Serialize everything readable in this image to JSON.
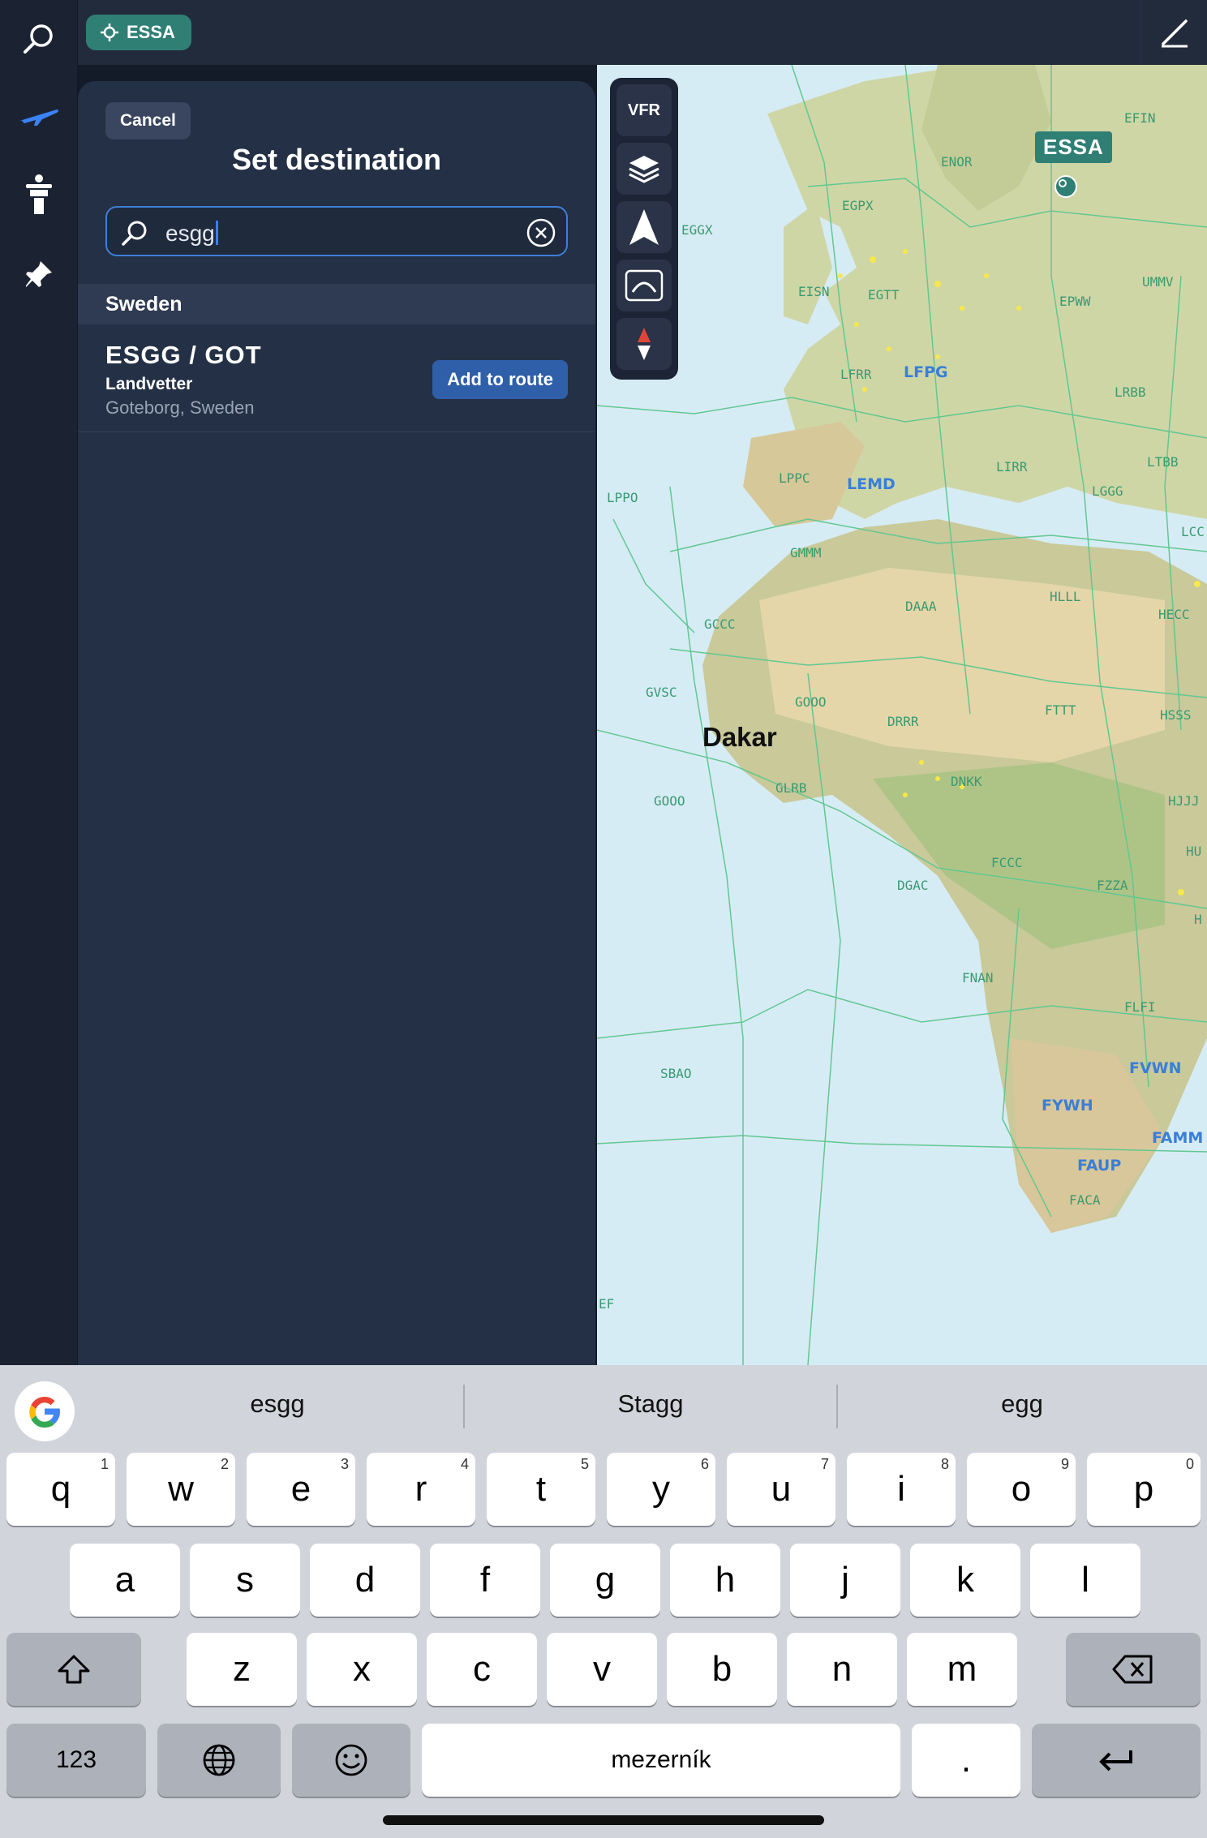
{
  "topbar": {
    "origin_chip": "ESSA"
  },
  "sheet": {
    "cancel_label": "Cancel",
    "title": "Set destination",
    "search_value": "esgg",
    "section": "Sweden",
    "result": {
      "code": "ESGG / GOT",
      "name": "Landvetter",
      "location": "Goteborg, Sweden",
      "action": "Add to route"
    }
  },
  "map": {
    "tools": [
      "VFR",
      "layers-icon",
      "navigation-arrow-icon",
      "route-icon",
      "compass-icon"
    ],
    "vfr_label": "VFR",
    "origin_tag": "ESSA",
    "city": "Dakar",
    "fir_labels": [
      "EFIN",
      "ENOR",
      "EGPX",
      "EGGX",
      "EISN",
      "EGTT",
      "UMMV",
      "EPWW",
      "LFRR",
      "LRBB",
      "LPPC",
      "LIRR",
      "LTBB",
      "LPPO",
      "LGGG",
      "LCC",
      "GMMM",
      "HLLL",
      "DAAA",
      "HECC",
      "GCCC",
      "GVSC",
      "GOOO",
      "FTTT",
      "HSSS",
      "DRRR",
      "DNKK",
      "GLRB",
      "GOOO",
      "HJJJ",
      "HU",
      "FCCC",
      "DGAC",
      "FZZA",
      "H",
      "FNAN",
      "FLFI",
      "SBAO",
      "FACA",
      "EF"
    ],
    "airports": [
      "LFPG",
      "LEMD",
      "FVWN",
      "FYWH",
      "FAMM",
      "FAUP"
    ],
    "colors": {
      "sea": "#d6ecf5",
      "land": "#c9d4a3",
      "fir_line": "#63c790",
      "airport": "#3a7ed8",
      "accent": "#2f7f74"
    }
  },
  "keyboard": {
    "suggestions": [
      "esgg",
      "Stagg",
      "egg"
    ],
    "row1": [
      [
        "q",
        "1"
      ],
      [
        "w",
        "2"
      ],
      [
        "e",
        "3"
      ],
      [
        "r",
        "4"
      ],
      [
        "t",
        "5"
      ],
      [
        "y",
        "6"
      ],
      [
        "u",
        "7"
      ],
      [
        "i",
        "8"
      ],
      [
        "o",
        "9"
      ],
      [
        "p",
        "0"
      ]
    ],
    "row2": [
      "a",
      "s",
      "d",
      "f",
      "g",
      "h",
      "j",
      "k",
      "l"
    ],
    "row3": [
      "z",
      "x",
      "c",
      "v",
      "b",
      "n",
      "m"
    ],
    "numbers_label": "123",
    "space_label": "mezerník",
    "period_label": "."
  }
}
